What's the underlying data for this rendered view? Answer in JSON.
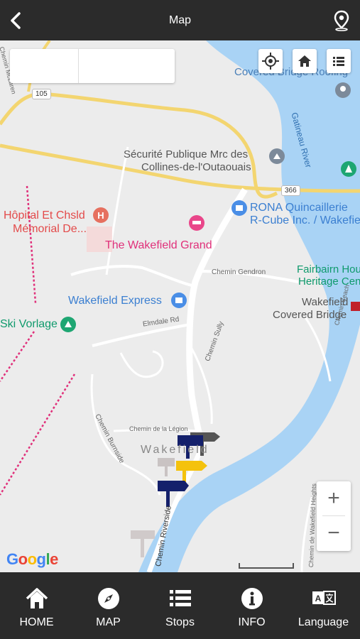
{
  "header": {
    "title": "Map",
    "back_icon": "chevron-left-icon",
    "action_icon": "location-pin-icon"
  },
  "map": {
    "labels": {
      "covered_bridge_roofing": "Covered Bridge Roofing",
      "gatineau_river": "Gatineau River",
      "securite_1": "Sécurité Publique Mrc des",
      "securite_2": "Collines-de-l'Outaouais",
      "hopital_1": "Hôpital Et Chsld",
      "hopital_2": "Mémorial De...",
      "rona_1": "RONA Quincaillerie",
      "rona_2": "R-Cube Inc. / Wakefield",
      "wakefield_grand": "The Wakefield Grand",
      "fairbairn_1": "Fairbairn House",
      "fairbairn_2": "Heritage Centre",
      "chemin_gendron": "Chemin Gendron",
      "wakefield_express": "Wakefield Express",
      "wakefield_cb_1": "Wakefield",
      "wakefield_cb_2": "Covered Bridge",
      "ski_vorlage": "Ski Vorlage",
      "elmdale": "Elmdale Rd",
      "chemin_beach": "Chemin Beach",
      "chemin_sully": "Chemin Sully",
      "chemin_legion": "Chemin de la Légion",
      "chemin_burnside": "Chemin Burnside",
      "wakefield_town": "Wakefield",
      "chemin_riverside": "Chemin Riverside",
      "chemin_wakefield_heights": "Chemin de Wakefield Heights",
      "chemin_mclaren": "Chemin McLaren",
      "hwy_105": "105",
      "hwy_366": "366",
      "google": "Google"
    },
    "controls": {
      "locate_icon": "crosshair-icon",
      "home_icon": "home-icon",
      "list_icon": "list-icon",
      "zoom_in": "+",
      "zoom_out": "−"
    },
    "colors": {
      "water": "#a9d3f5",
      "highway": "#f3d570",
      "road": "#ffffff",
      "marker_navy": "#14206b",
      "marker_yellow": "#f4c20d",
      "marker_gray": "#555555",
      "marker_light": "#c9c3c3"
    }
  },
  "tabs": [
    {
      "label": "HOME",
      "icon": "home-icon"
    },
    {
      "label": "MAP",
      "icon": "compass-icon"
    },
    {
      "label": "Stops",
      "icon": "list-icon"
    },
    {
      "label": "INFO",
      "icon": "info-icon"
    },
    {
      "label": "Language",
      "icon": "translate-icon"
    }
  ]
}
